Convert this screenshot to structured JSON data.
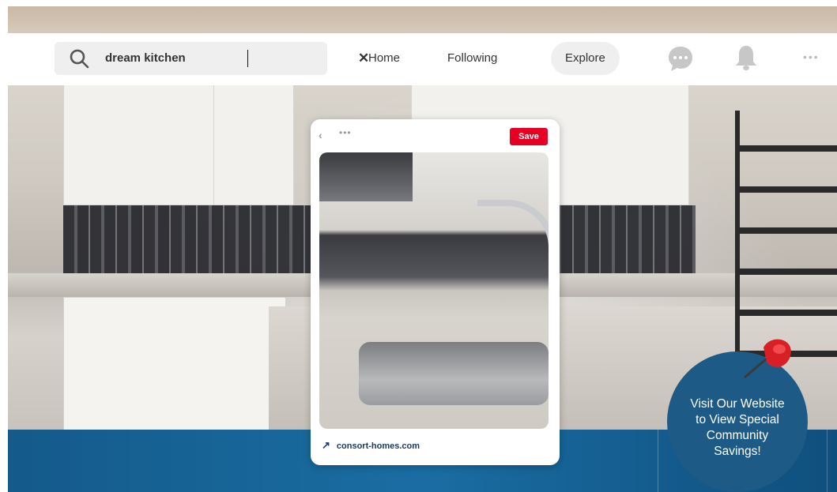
{
  "nav": {
    "search_value": "dream kitchen",
    "links": [
      {
        "label": "Home"
      },
      {
        "label": "Following"
      },
      {
        "label": "Explore"
      }
    ],
    "icons": {
      "search": "search-icon",
      "clear": "close-icon",
      "chat": "chat-icon",
      "bell": "bell-icon",
      "more": "more-icon"
    },
    "more_glyph": "•••",
    "clear_glyph": "✕"
  },
  "pin": {
    "back_glyph": "‹",
    "more_glyph": "•••",
    "save_label": "Save",
    "link_arrow": "↗",
    "link_text": "consort-homes.com"
  },
  "promo": {
    "lines": [
      "Visit Our Website",
      "to View Special",
      "Community",
      "Savings!"
    ]
  },
  "colors": {
    "save_red": "#e60023",
    "promo_blue": "#1e5a86",
    "banner_blue": "#1a6da3",
    "pushpin_red": "#d81f26"
  }
}
